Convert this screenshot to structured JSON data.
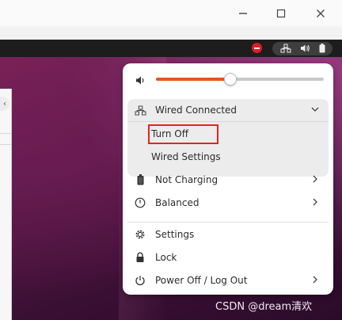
{
  "menu": {
    "volume_percent": 44,
    "wired": {
      "label": "Wired Connected",
      "turn_off_label": "Turn Off",
      "settings_label": "Wired Settings"
    },
    "power": {
      "not_charging_label": "Not Charging",
      "balanced_label": "Balanced"
    },
    "system": {
      "settings_label": "Settings",
      "lock_label": "Lock",
      "power_off_label": "Power Off / Log Out"
    }
  },
  "watermark": "CSDN @dream清欢",
  "colors": {
    "accent": "#e95420",
    "highlight_box": "#e5241f",
    "topbar": "#1d1d1d",
    "menu_bg": "#ffffff"
  },
  "icons": {
    "minimize": "minimize-icon",
    "maximize": "maximize-icon",
    "close": "close-icon",
    "volume": "volume-icon",
    "network": "network-wired-icon",
    "battery": "battery-icon",
    "power_mode": "power-mode-icon",
    "settings": "gear-icon",
    "lock": "lock-icon",
    "power": "power-icon"
  }
}
